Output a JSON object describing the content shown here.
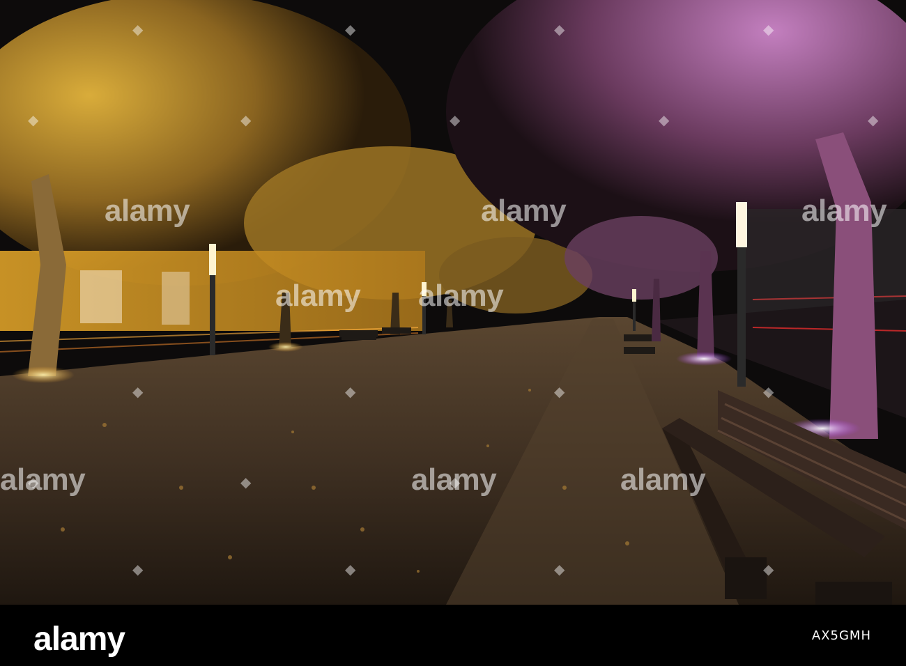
{
  "photo": {
    "watermark": "alamy",
    "watermark_dot": "◆"
  },
  "footer": {
    "logo": "alamy",
    "image_id": "AX5GMH"
  },
  "colors": {
    "sky": "#0d0b0b",
    "warm_foliage": "#c99a2c",
    "pink_foliage": "#b06aa8",
    "pavement": "#4a3a2a",
    "tram": "#e0a028"
  }
}
